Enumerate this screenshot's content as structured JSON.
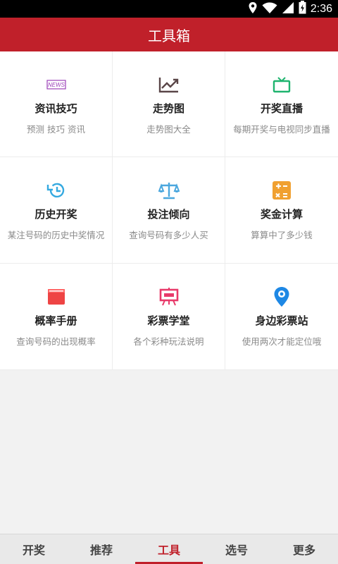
{
  "status_bar": {
    "time": "2:36"
  },
  "header": {
    "title": "工具箱"
  },
  "tools": [
    {
      "label": "资讯技巧",
      "sub": "预测 技巧 资讯",
      "icon": "news-icon",
      "color": "#9b3fb8"
    },
    {
      "label": "走势图",
      "sub": "走势图大全",
      "icon": "trend-chart-icon",
      "color": "#5a4648"
    },
    {
      "label": "开奖直播",
      "sub": "每期开奖与电视同步直播",
      "icon": "tv-icon",
      "color": "#1fb46f"
    },
    {
      "label": "历史开奖",
      "sub": "某注号码的历史中奖情况",
      "icon": "history-icon",
      "color": "#35a9e0"
    },
    {
      "label": "投注倾向",
      "sub": "查询号码有多少人买",
      "icon": "balance-scale-icon",
      "color": "#4aa7de"
    },
    {
      "label": "奖金计算",
      "sub": "算算中了多少钱",
      "icon": "calculator-icon",
      "color": "#f0a030"
    },
    {
      "label": "概率手册",
      "sub": "查询号码的出现概率",
      "icon": "book-icon",
      "color": "#ee4444"
    },
    {
      "label": "彩票学堂",
      "sub": "各个彩种玩法说明",
      "icon": "easel-board-icon",
      "color": "#e83a6a"
    },
    {
      "label": "身边彩票站",
      "sub": "使用两次才能定位哦",
      "icon": "location-pin-icon",
      "color": "#1e88e5"
    }
  ],
  "tabs": [
    {
      "label": "开奖",
      "active": false
    },
    {
      "label": "推荐",
      "active": false
    },
    {
      "label": "工具",
      "active": true
    },
    {
      "label": "选号",
      "active": false
    },
    {
      "label": "更多",
      "active": false
    }
  ],
  "accent_color": "#c0202a"
}
